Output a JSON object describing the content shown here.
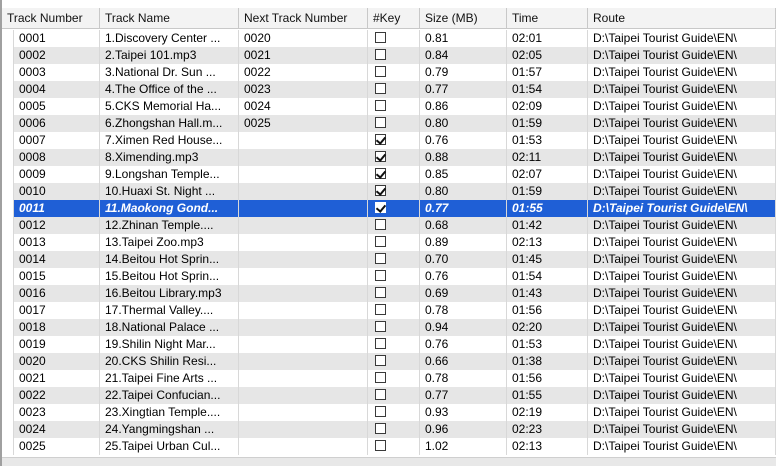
{
  "columns": [
    "Track Number",
    "Track Name",
    "Next Track Number",
    "#Key",
    "Size (MB)",
    "Time",
    "Route"
  ],
  "rows": [
    {
      "num": "0001",
      "name": "1.Discovery Center ...",
      "next": "0020",
      "key": false,
      "size": "0.81",
      "time": "02:01",
      "route": "D:\\Taipei Tourist Guide\\EN\\"
    },
    {
      "num": "0002",
      "name": "2.Taipei 101.mp3",
      "next": "0021",
      "key": false,
      "size": "0.84",
      "time": "02:05",
      "route": "D:\\Taipei Tourist Guide\\EN\\"
    },
    {
      "num": "0003",
      "name": "3.National Dr. Sun ...",
      "next": "0022",
      "key": false,
      "size": "0.79",
      "time": "01:57",
      "route": "D:\\Taipei Tourist Guide\\EN\\"
    },
    {
      "num": "0004",
      "name": "4.The Office of the ...",
      "next": "0023",
      "key": false,
      "size": "0.77",
      "time": "01:54",
      "route": "D:\\Taipei Tourist Guide\\EN\\"
    },
    {
      "num": "0005",
      "name": "5.CKS Memorial Ha...",
      "next": "0024",
      "key": false,
      "size": "0.86",
      "time": "02:09",
      "route": "D:\\Taipei Tourist Guide\\EN\\"
    },
    {
      "num": "0006",
      "name": "6.Zhongshan Hall.m...",
      "next": "0025",
      "key": false,
      "size": "0.80",
      "time": "01:59",
      "route": "D:\\Taipei Tourist Guide\\EN\\"
    },
    {
      "num": "0007",
      "name": "7.Ximen Red House...",
      "next": "",
      "key": true,
      "size": "0.76",
      "time": "01:53",
      "route": "D:\\Taipei Tourist Guide\\EN\\"
    },
    {
      "num": "0008",
      "name": "8.Ximending.mp3",
      "next": "",
      "key": true,
      "size": "0.88",
      "time": "02:11",
      "route": "D:\\Taipei Tourist Guide\\EN\\"
    },
    {
      "num": "0009",
      "name": "9.Longshan Temple...",
      "next": "",
      "key": true,
      "size": "0.85",
      "time": "02:07",
      "route": "D:\\Taipei Tourist Guide\\EN\\"
    },
    {
      "num": "0010",
      "name": "10.Huaxi St. Night ...",
      "next": "",
      "key": true,
      "size": "0.80",
      "time": "01:59",
      "route": "D:\\Taipei Tourist Guide\\EN\\"
    },
    {
      "num": "0011",
      "name": "11.Maokong Gond...",
      "next": "",
      "key": true,
      "size": "0.77",
      "time": "01:55",
      "route": "D:\\Taipei Tourist Guide\\EN\\",
      "selected": true
    },
    {
      "num": "0012",
      "name": "12.Zhinan Temple....",
      "next": "",
      "key": false,
      "size": "0.68",
      "time": "01:42",
      "route": "D:\\Taipei Tourist Guide\\EN\\"
    },
    {
      "num": "0013",
      "name": "13.Taipei Zoo.mp3",
      "next": "",
      "key": false,
      "size": "0.89",
      "time": "02:13",
      "route": "D:\\Taipei Tourist Guide\\EN\\"
    },
    {
      "num": "0014",
      "name": "14.Beitou Hot Sprin...",
      "next": "",
      "key": false,
      "size": "0.70",
      "time": "01:45",
      "route": "D:\\Taipei Tourist Guide\\EN\\"
    },
    {
      "num": "0015",
      "name": "15.Beitou Hot Sprin...",
      "next": "",
      "key": false,
      "size": "0.76",
      "time": "01:54",
      "route": "D:\\Taipei Tourist Guide\\EN\\"
    },
    {
      "num": "0016",
      "name": "16.Beitou Library.mp3",
      "next": "",
      "key": false,
      "size": "0.69",
      "time": "01:43",
      "route": "D:\\Taipei Tourist Guide\\EN\\"
    },
    {
      "num": "0017",
      "name": "17.Thermal Valley....",
      "next": "",
      "key": false,
      "size": "0.78",
      "time": "01:56",
      "route": "D:\\Taipei Tourist Guide\\EN\\"
    },
    {
      "num": "0018",
      "name": "18.National Palace ...",
      "next": "",
      "key": false,
      "size": "0.94",
      "time": "02:20",
      "route": "D:\\Taipei Tourist Guide\\EN\\"
    },
    {
      "num": "0019",
      "name": "19.Shilin Night Mar...",
      "next": "",
      "key": false,
      "size": "0.76",
      "time": "01:53",
      "route": "D:\\Taipei Tourist Guide\\EN\\"
    },
    {
      "num": "0020",
      "name": "20.CKS Shilin Resi...",
      "next": "",
      "key": false,
      "size": "0.66",
      "time": "01:38",
      "route": "D:\\Taipei Tourist Guide\\EN\\"
    },
    {
      "num": "0021",
      "name": "21.Taipei Fine Arts ...",
      "next": "",
      "key": false,
      "size": "0.78",
      "time": "01:56",
      "route": "D:\\Taipei Tourist Guide\\EN\\"
    },
    {
      "num": "0022",
      "name": "22.Taipei Confucian...",
      "next": "",
      "key": false,
      "size": "0.77",
      "time": "01:55",
      "route": "D:\\Taipei Tourist Guide\\EN\\"
    },
    {
      "num": "0023",
      "name": "23.Xingtian Temple....",
      "next": "",
      "key": false,
      "size": "0.93",
      "time": "02:19",
      "route": "D:\\Taipei Tourist Guide\\EN\\"
    },
    {
      "num": "0024",
      "name": "24.Yangmingshan ...",
      "next": "",
      "key": false,
      "size": "0.96",
      "time": "02:23",
      "route": "D:\\Taipei Tourist Guide\\EN\\"
    },
    {
      "num": "0025",
      "name": "25.Taipei Urban Cul...",
      "next": "",
      "key": false,
      "size": "1.02",
      "time": "02:13",
      "route": "D:\\Taipei Tourist Guide\\EN\\"
    }
  ],
  "colors": {
    "selection": "#1f5fd6",
    "alt_row": "#e6e6e6",
    "header": "#f3f3f3"
  }
}
